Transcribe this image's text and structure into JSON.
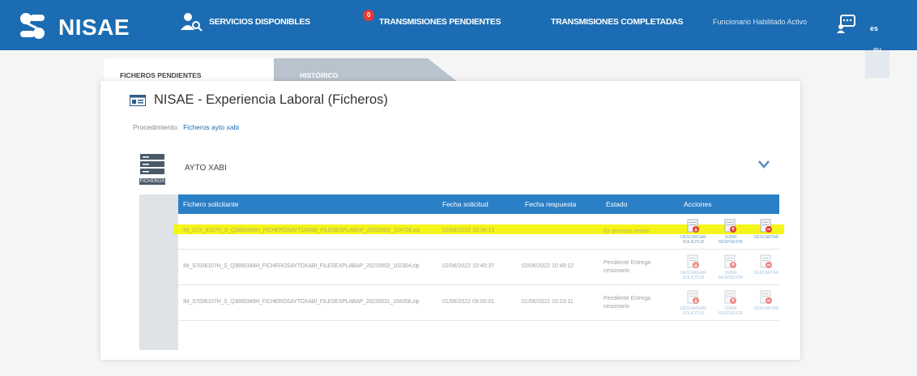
{
  "app": {
    "name": "NISAE"
  },
  "nav": {
    "services": "SERVICIOS DISPONIBLES",
    "pending": "TRANSMISIONES PENDIENTES",
    "pending_count": "0",
    "completed": "TRANSMISIONES COMPLETADAS",
    "user_status": "Funcionario Habilitado Activo",
    "lang_es": "es",
    "lang_eu": "eu"
  },
  "tabs": {
    "pending": "FICHEROS PENDIENTES",
    "history": "HISTÓRICO"
  },
  "page": {
    "title": "NISAE - Experiencia Laboral (Ficheros)",
    "proc_label": "Procedimiento:",
    "proc_value": "Ficheros ayto xabi"
  },
  "section": {
    "name": "AYTO XABI",
    "icon_label": "FICHEROS"
  },
  "table": {
    "headers": {
      "file": "Fichero solicitante",
      "req_date": "Fecha solicitud",
      "resp_date": "Fecha respuesta",
      "status": "Estado",
      "actions": "Acciones"
    },
    "rows": [
      {
        "file": "IM_S7X_6107H_S_Q3890349H_FICHEROSAYTOXABI_FILESEXPLABAP_20220602_104708.zip",
        "req_date": "02/06/2022 10:38:19",
        "resp_date": "",
        "status": "En proceso cesión"
      },
      {
        "file": "IM_S7036107H_S_Q3890349H_FICHEROSAYTOXABI_FILESEXPLABAP_20220602_102304.zip",
        "req_date": "02/06/2022 10:40:37",
        "resp_date": "02/06/2022 10:49:12",
        "status": "Pendiente Entrega cesionario"
      },
      {
        "file": "IM_S7036107H_S_Q3890349H_FICHEROSAYTOXABI_FILESEXPLABAP_20220531_104208.zip",
        "req_date": "01/06/2022 09:00:01",
        "resp_date": "01/06/2022 10:23:11",
        "status": "Pendiente Entrega cesionario"
      }
    ],
    "actions": {
      "download_request": "DESCARGAR SOLICITUD",
      "upload_response": "SUBIR RESPUESTA",
      "discard": "DESCARTAR"
    }
  }
}
